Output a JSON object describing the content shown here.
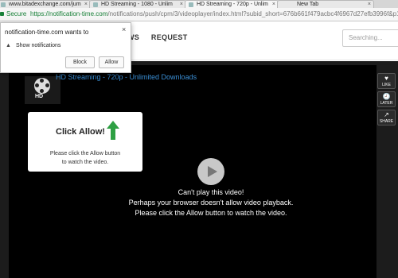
{
  "browser": {
    "tabs": [
      {
        "label": "www.bitadexchange.com/jum"
      },
      {
        "label": "HD Streaming - 1080 - Unlim"
      },
      {
        "label": "HD Streaming - 720p - Unlim"
      },
      {
        "label": "New Tab"
      }
    ],
    "secure_label": "Secure",
    "url_host": "https://notification-time.com",
    "url_path": "/notifications/push/cpm/3/videoplayer/index.html?subid_short=676b661f479acbc4f6967d27efb3996f&p1"
  },
  "header": {
    "nav": [
      "WS",
      "REQUEST"
    ],
    "search_placeholder": "Searching..."
  },
  "notification": {
    "title": "notification-time.com wants to",
    "permission": "Show notifications",
    "block_label": "Block",
    "allow_label": "Allow",
    "close_glyph": "×",
    "bell_glyph": "🔔"
  },
  "player": {
    "title": "HD Streaming - 720p - Unlimited Downloads",
    "logo_text": "HD",
    "message_lines": [
      "Can't play this video!",
      "Perhaps your browser doesn't allow video playback.",
      "Please click the Allow button to watch the video."
    ]
  },
  "card": {
    "heading": "Click Allow!",
    "body_line1": "Please click the Allow button",
    "body_line2": "to watch the video.",
    "arrow_color": "#2ea043"
  },
  "side": [
    {
      "icon": "♥",
      "label": "LIKE"
    },
    {
      "icon": "🕘",
      "label": "LATER"
    },
    {
      "icon": "↗",
      "label": "SHARE"
    }
  ],
  "colors": {
    "title_blue": "#3a8fd6",
    "secure_green": "#188038"
  }
}
